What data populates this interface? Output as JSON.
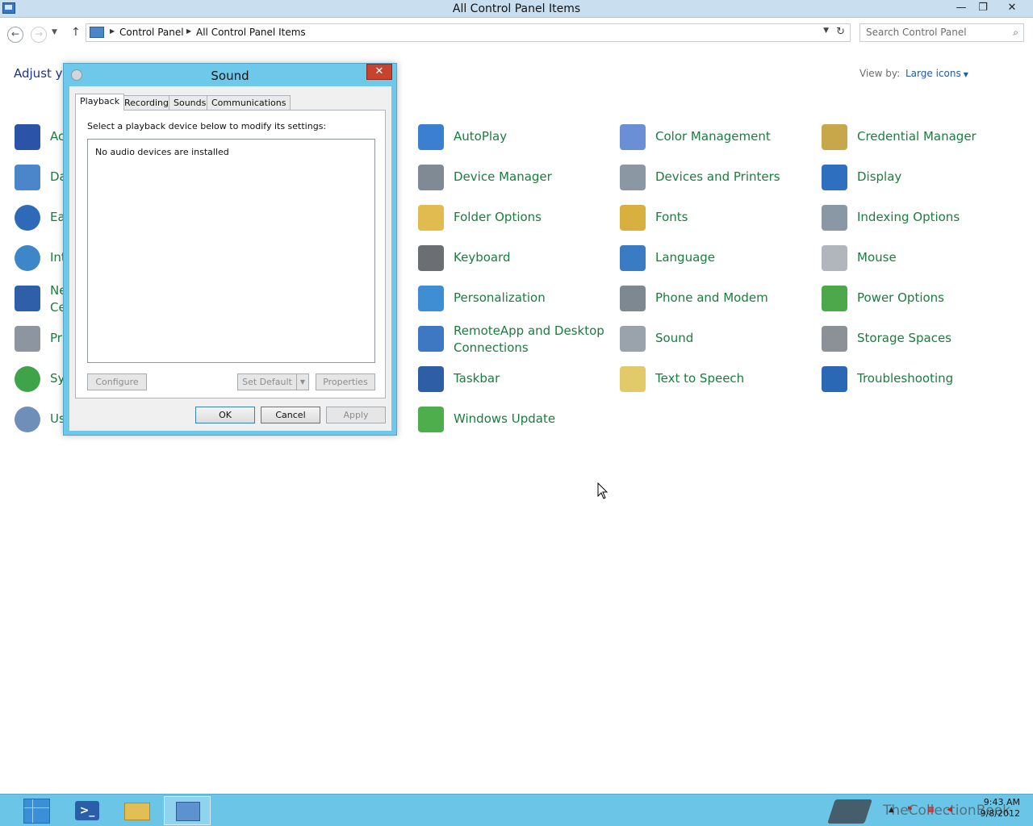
{
  "window": {
    "title": "All Control Panel Items",
    "min_label": "—",
    "max_label": "❐",
    "close_label": "✕"
  },
  "address": {
    "crumbs": [
      "Control Panel",
      "All Control Panel Items"
    ],
    "search_placeholder": "Search Control Panel"
  },
  "content": {
    "heading": "Adjust yo",
    "view_by_label": "View by:",
    "view_by_value": "Large icons"
  },
  "left_column_partial": [
    "Ac",
    "Da",
    "Ea",
    "Int",
    "Ne\nCe",
    "Pr",
    "Sy",
    "Us"
  ],
  "items": [
    {
      "label": "AutoPlay",
      "icon": "autoplay-icon",
      "color": "#3b7fd0"
    },
    {
      "label": "Color Management",
      "icon": "color-management-icon",
      "color": "#6a8fd6"
    },
    {
      "label": "Credential Manager",
      "icon": "credential-manager-icon",
      "color": "#c8a64a"
    },
    {
      "label": "Device Manager",
      "icon": "device-manager-icon",
      "color": "#7f8a94"
    },
    {
      "label": "Devices and Printers",
      "icon": "devices-printers-icon",
      "color": "#8b97a3"
    },
    {
      "label": "Display",
      "icon": "display-icon",
      "color": "#2f6fbf"
    },
    {
      "label": "Folder Options",
      "icon": "folder-options-icon",
      "color": "#e0bb4f"
    },
    {
      "label": "Fonts",
      "icon": "fonts-icon",
      "color": "#d7b040"
    },
    {
      "label": "Indexing Options",
      "icon": "indexing-options-icon",
      "color": "#8a98a6"
    },
    {
      "label": "Keyboard",
      "icon": "keyboard-icon",
      "color": "#6b6f74"
    },
    {
      "label": "Language",
      "icon": "language-icon",
      "color": "#3a7cc4"
    },
    {
      "label": "Mouse",
      "icon": "mouse-icon",
      "color": "#b0b6bc"
    },
    {
      "label": "Personalization",
      "icon": "personalization-icon",
      "color": "#3f8ed3"
    },
    {
      "label": "Phone and Modem",
      "icon": "phone-modem-icon",
      "color": "#7e8891"
    },
    {
      "label": "Power Options",
      "icon": "power-options-icon",
      "color": "#4ca84a"
    },
    {
      "label": "RemoteApp and Desktop Connections",
      "icon": "remoteapp-icon",
      "color": "#3e78c2"
    },
    {
      "label": "Sound",
      "icon": "sound-icon",
      "color": "#9aa3ab"
    },
    {
      "label": "Storage Spaces",
      "icon": "storage-spaces-icon",
      "color": "#8b9196"
    },
    {
      "label": "Taskbar",
      "icon": "taskbar-icon",
      "color": "#2d5ea6"
    },
    {
      "label": "Text to Speech",
      "icon": "text-to-speech-icon",
      "color": "#e2c96a"
    },
    {
      "label": "Troubleshooting",
      "icon": "troubleshooting-icon",
      "color": "#2a67b4"
    },
    {
      "label": "Windows Update",
      "icon": "windows-update-icon",
      "color": "#4fae4c"
    }
  ],
  "dialog": {
    "title": "Sound",
    "close_label": "✕",
    "tabs": [
      "Playback",
      "Recording",
      "Sounds",
      "Communications"
    ],
    "instruction": "Select a playback device below to modify its settings:",
    "empty_message": "No audio devices are installed",
    "buttons": {
      "configure": "Configure",
      "set_default": "Set Default",
      "properties": "Properties",
      "ok": "OK",
      "cancel": "Cancel",
      "apply": "Apply"
    }
  },
  "taskbar": {
    "watermark": "TheCollectionBook",
    "time": "9:43 AM",
    "date": "9/8/2012"
  }
}
